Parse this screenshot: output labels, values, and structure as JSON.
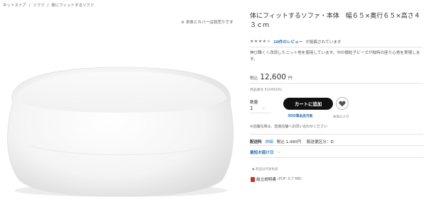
{
  "breadcrumb": [
    "ネットストア",
    "/",
    "ソファ",
    "/",
    "体にフィットするソファ"
  ],
  "image_note": "※ 本体とカバーは別売りです",
  "product": {
    "title": "体にフィットするソファ・本体　幅６５×奥行６５×高さ４３ｃｍ",
    "rating": {
      "stars": 4.5,
      "review_link": "10件のレビュー",
      "review_suffix": "が投稿されています"
    },
    "description": "伸び難くく改良したニット地を使用しています。中の微粒子ビーズが独特の座り心地を実現します。",
    "price": {
      "tax_label": "税込",
      "value": "12,600",
      "unit": "円"
    },
    "code": "商品番号 61049182"
  },
  "purchase": {
    "qty_label": "数量",
    "qty_value": "1",
    "cart_button": "カートに追加",
    "return_link": "30日間返品可能",
    "fav_label": "お気に入り"
  },
  "store_note": "※店舗在庫は、直接店舗へお問い合わせください",
  "delivery": {
    "label": "配送料",
    "detail_link": "詳細",
    "value": "税込 1,490円",
    "category": "配送便区分：D"
  },
  "earliest": "最短お届け日",
  "small_note": "◆ 商品は代表色表",
  "manual": {
    "label": "組立説明書",
    "size": "(PDF: 0.7 MB)"
  },
  "colors": {
    "link": "#2c6fb0",
    "button": "#111111",
    "pdf": "#c8322a"
  }
}
